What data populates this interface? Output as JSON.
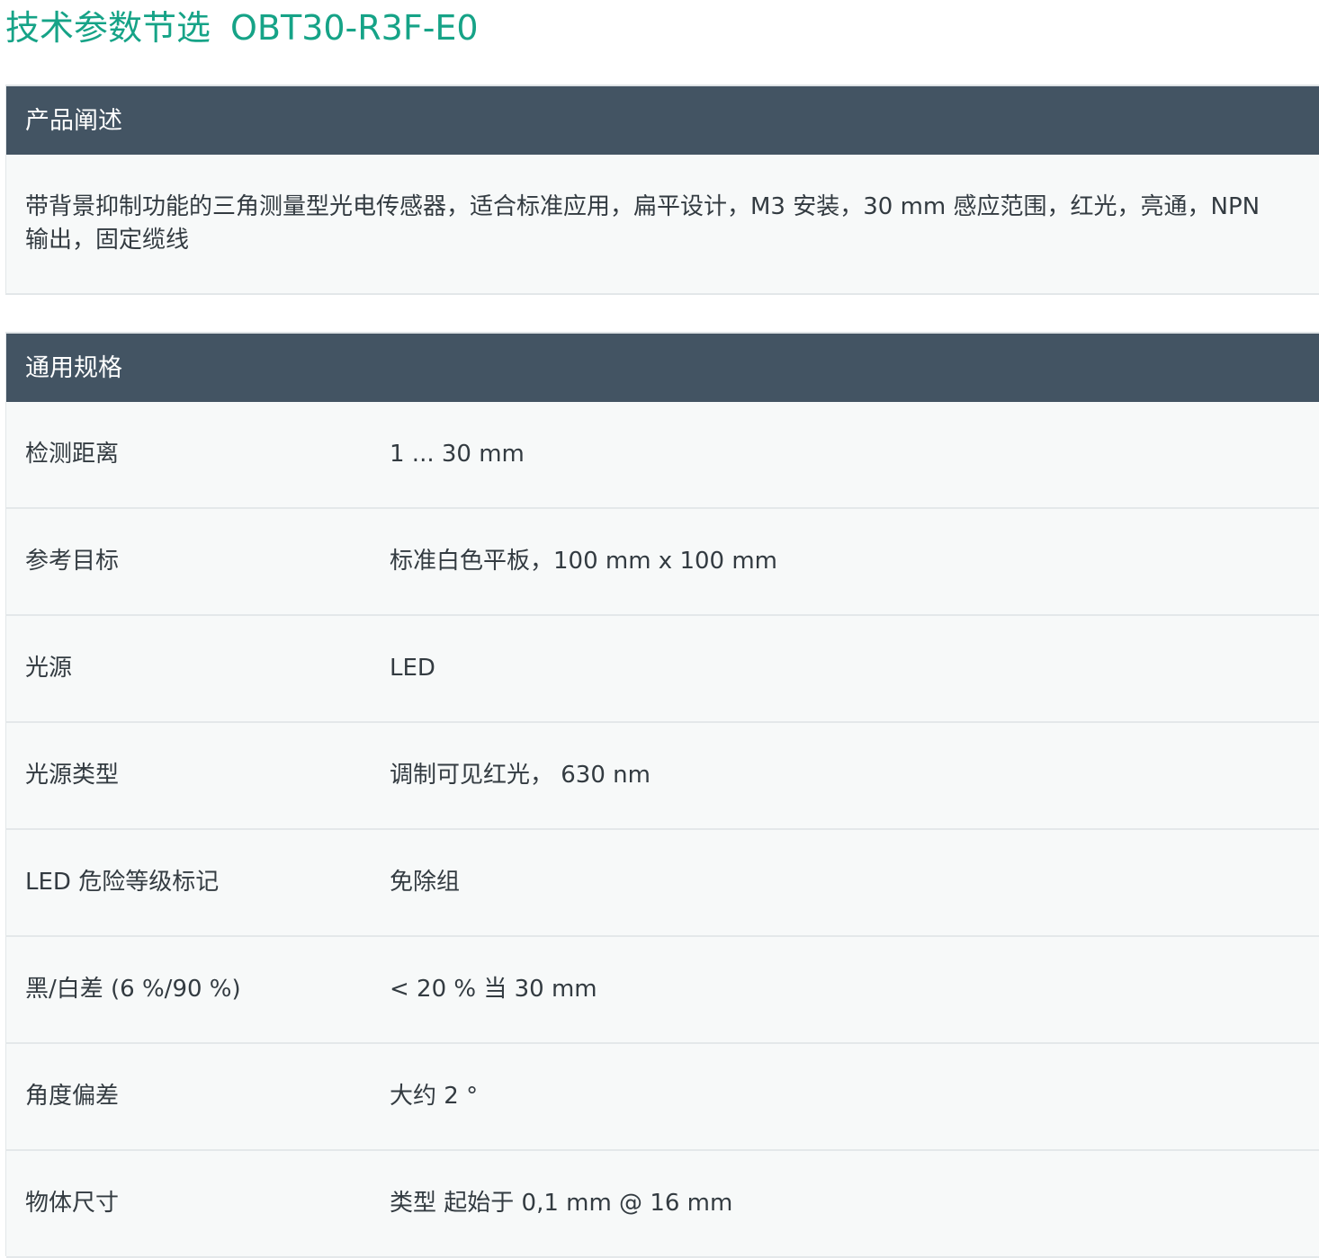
{
  "page": {
    "title": "技术参数节选",
    "model": "OBT30-R3F-E0"
  },
  "description": {
    "header": "产品阐述",
    "text": "带背景抑制功能的三角测量型光电传感器，适合标准应用，扁平设计，M3 安装，30 mm 感应范围，红光，亮通，NPN 输出，固定缆线"
  },
  "general": {
    "header": "通用规格",
    "rows": [
      {
        "label": "检测距离",
        "value": "1 ... 30 mm"
      },
      {
        "label": "参考目标",
        "value": "标准白色平板，100 mm x 100 mm"
      },
      {
        "label": "光源",
        "value": "LED"
      },
      {
        "label": "光源类型",
        "value": "调制可见红光， 630 nm"
      },
      {
        "label": "LED 危险等级标记",
        "value": "免除组"
      },
      {
        "label": "黑/白差 (6 %/90 %)",
        "value": "< 20 % 当 30 mm"
      },
      {
        "label": "角度偏差",
        "value": "大约 2 °"
      },
      {
        "label": "物体尺寸",
        "value": "类型 起始于 0,1 mm @ 16 mm"
      }
    ]
  },
  "colors": {
    "title": "#16a387",
    "header_bg": "#435463",
    "body_bg": "#f7f9f9"
  }
}
